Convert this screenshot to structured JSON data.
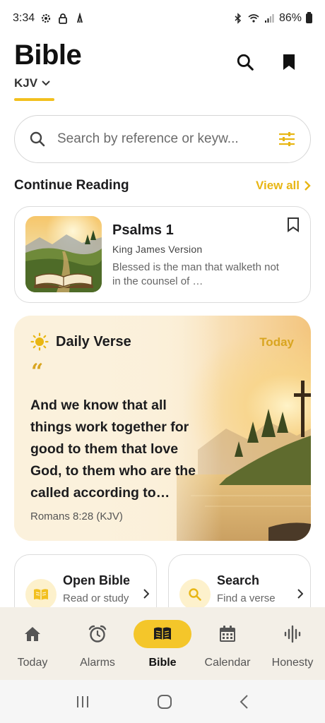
{
  "status_bar": {
    "time": "3:34",
    "battery": "86%"
  },
  "header": {
    "title": "Bible",
    "translation": "KJV"
  },
  "search": {
    "placeholder": "Search by reference or keyw..."
  },
  "continue_reading": {
    "section_title": "Continue Reading",
    "view_all": "View all",
    "card": {
      "title": "Psalms 1",
      "version": "King James Version",
      "excerpt": "Blessed is the man that walketh not in the counsel of …"
    }
  },
  "daily_verse": {
    "label": "Daily Verse",
    "today": "Today",
    "quote_mark": "“",
    "text": "And we know that all things work together for good to them that love God, to them who are the called according to…",
    "reference": "Romans 8:28 (KJV)"
  },
  "actions": [
    {
      "title": "Open Bible",
      "subtitle": "Read or study the Bible",
      "icon": "book-open-icon"
    },
    {
      "title": "Search",
      "subtitle": "Find a verse or word",
      "icon": "search-icon"
    }
  ],
  "bottom_nav": [
    {
      "label": "Today",
      "icon": "home-icon"
    },
    {
      "label": "Alarms",
      "icon": "alarm-clock-icon"
    },
    {
      "label": "Bible",
      "icon": "book-icon",
      "active": true
    },
    {
      "label": "Calendar",
      "icon": "calendar-icon"
    },
    {
      "label": "Honesty",
      "icon": "waveform-icon"
    }
  ],
  "colors": {
    "accent": "#f2c01e",
    "accent_text": "#e8b614",
    "nav_bg": "#f3efe7"
  }
}
